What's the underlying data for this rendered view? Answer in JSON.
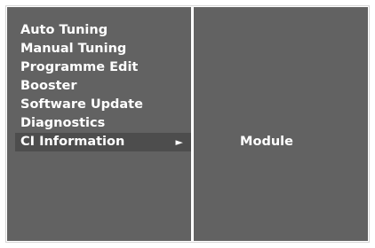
{
  "menu": {
    "items": [
      {
        "label": "Auto Tuning"
      },
      {
        "label": "Manual Tuning"
      },
      {
        "label": "Programme Edit"
      },
      {
        "label": "Booster"
      },
      {
        "label": "Software Update"
      },
      {
        "label": "Diagnostics"
      },
      {
        "label": "CI Information",
        "selected": true,
        "arrow": "►"
      }
    ]
  },
  "submenu": {
    "items": [
      {
        "label": "Module"
      }
    ]
  },
  "colors": {
    "panel_background": "#626262",
    "selected_background": "#4d4d4d",
    "text": "#ffffff",
    "divider": "#ffffff"
  }
}
